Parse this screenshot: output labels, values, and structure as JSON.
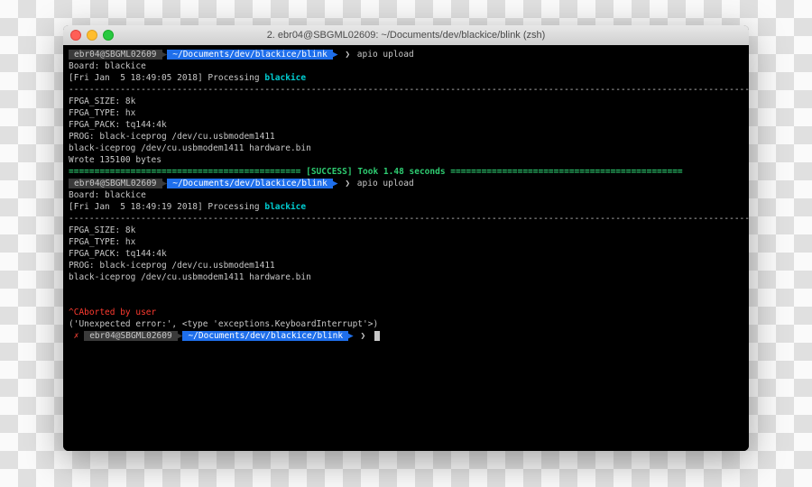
{
  "window": {
    "title": "2. ebr04@SBGML02609: ~/Documents/dev/blackice/blink (zsh)"
  },
  "prompt": {
    "host": "ebr04@SBGML02609",
    "path": "~/Documents/dev/blackice/blink",
    "chevron": "❯",
    "err_mark": "✗"
  },
  "run1": {
    "cmd": "apio upload",
    "board": "Board: blackice",
    "proc_prefix": "[Fri Jan  5 18:49:05 2018] Processing ",
    "proc_target": "blackice",
    "dashes": "--------------------------------------------------------------------------------------------------------------------------------------",
    "fpga_size": "FPGA_SIZE: 8k",
    "fpga_type": "FPGA_TYPE: hx",
    "fpga_pack": "FPGA_PACK: tq144:4k",
    "prog": "PROG: black-iceprog /dev/cu.usbmodem1411",
    "exec": "black-iceprog /dev/cu.usbmodem1411 hardware.bin",
    "wrote": "Wrote 135100 bytes",
    "bar_pre": "============================================= [",
    "success": "SUCCESS",
    "bar_post": "] Took 1.48 seconds ============================================="
  },
  "run2": {
    "cmd": "apio upload",
    "board": "Board: blackice",
    "proc_prefix": "[Fri Jan  5 18:49:19 2018] Processing ",
    "proc_target": "blackice",
    "dashes": "--------------------------------------------------------------------------------------------------------------------------------------",
    "fpga_size": "FPGA_SIZE: 8k",
    "fpga_type": "FPGA_TYPE: hx",
    "fpga_pack": "FPGA_PACK: tq144:4k",
    "prog": "PROG: black-iceprog /dev/cu.usbmodem1411",
    "exec": "black-iceprog /dev/cu.usbmodem1411 hardware.bin"
  },
  "abort": {
    "ctrlc": "^C",
    "msg": "Aborted by user",
    "err": "('Unexpected error:', <type 'exceptions.KeyboardInterrupt'>)"
  }
}
